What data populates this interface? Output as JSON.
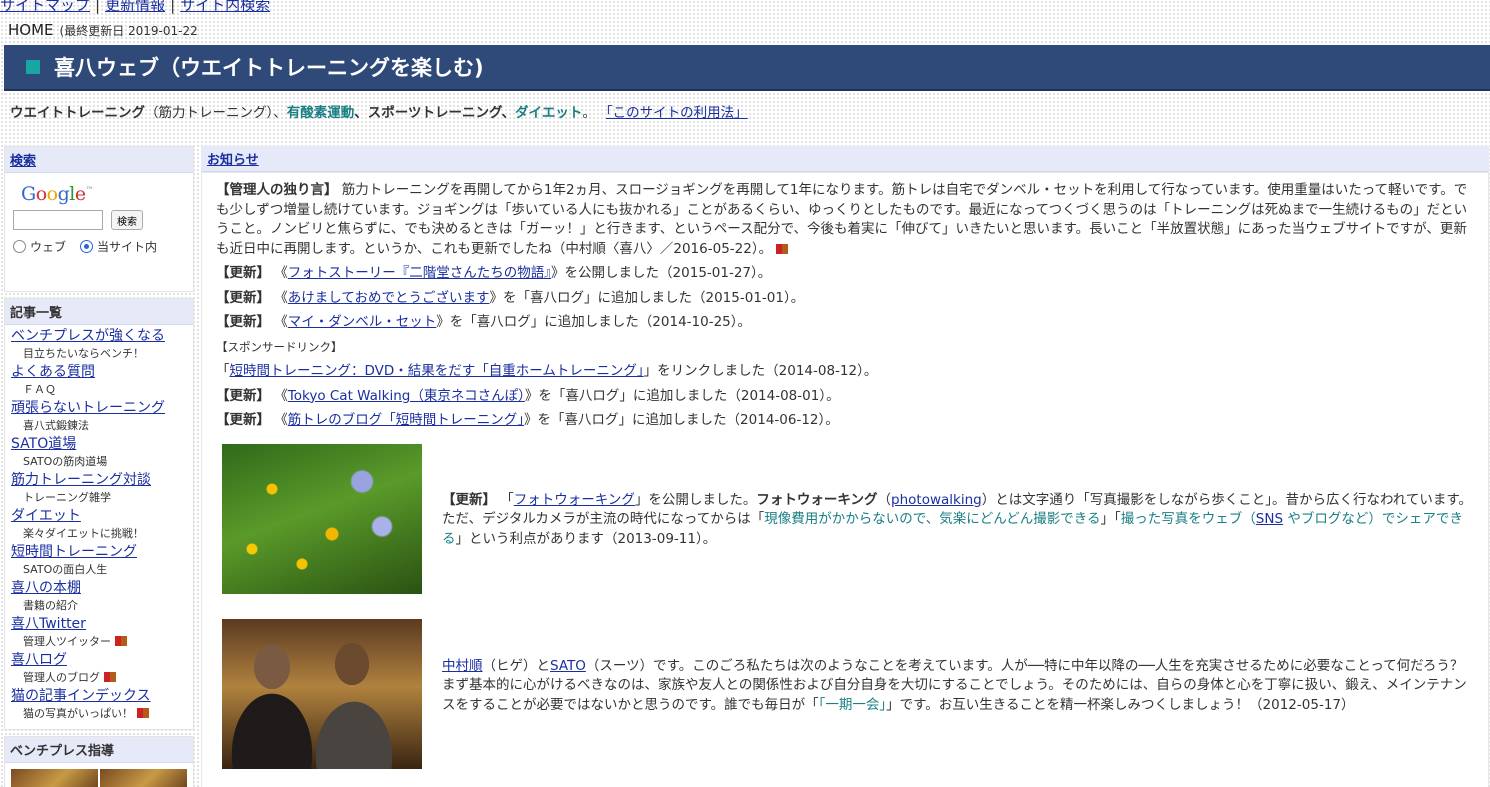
{
  "topnav": {
    "sitemap": "サイトマップ",
    "updates": "更新情報",
    "search": "サイト内検索",
    "sep": "|"
  },
  "home": {
    "label": "HOME",
    "updated": "(最終更新日 2019-01-22"
  },
  "banner": {
    "title": "喜八ウェブ（ウエイトトレーニングを楽しむ)"
  },
  "tagline": {
    "wt": "ウエイトトレーニング",
    "wt_note": "（筋力トレーニング）、",
    "aerobic": "有酸素運動",
    "sports": "、スポーツトレーニング、",
    "diet": "ダイエット",
    "period": "。",
    "howto": "「このサイトの利用法」"
  },
  "sidebar": {
    "search_title": "検索",
    "google": [
      "G",
      "o",
      "o",
      "g",
      "l",
      "e"
    ],
    "google_tm": "™",
    "search_button": "検索",
    "radio_web": "ウェブ",
    "radio_site": "当サイト内",
    "articles_title": "記事一覧",
    "articles": [
      {
        "label": "ベンチプレスが強くなる",
        "sub": "目立ちたいならベンチ！"
      },
      {
        "label": "よくある質問",
        "sub": "ＦＡＱ"
      },
      {
        "label": "頑張らないトレーニング",
        "sub": "喜八式鍛錬法"
      },
      {
        "label": "SATO道場",
        "sub": "SATOの筋肉道場"
      },
      {
        "label": "筋力トレーニング対談",
        "sub": "トレーニング雑学"
      },
      {
        "label": "ダイエット",
        "sub": "楽々ダイエットに挑戦！"
      },
      {
        "label": "短時間トレーニング",
        "sub": "SATOの面白人生"
      },
      {
        "label": "喜八の本棚",
        "sub": "書籍の紹介"
      },
      {
        "label": "喜八Twitter",
        "sub": "管理人ツイッター"
      },
      {
        "label": "喜八ログ",
        "sub": "管理人のブログ"
      },
      {
        "label": "猫の記事インデックス",
        "sub": "猫の写真がいっぱい！"
      }
    ],
    "bench_title": "ベンチプレス指導"
  },
  "main": {
    "title": "お知らせ",
    "notice": {
      "label": "【管理人の独り言】",
      "text": "筋力トレーニングを再開してから1年2ヵ月、スロージョギングを再開して1年になります。筋トレは自宅でダンベル・セットを利用して行なっています。使用重量はいたって軽いです。でも少しずつ増量し続けています。ジョギングは「歩いている人にも抜かれる」ことがあるくらい、ゆっくりとしたものです。最近になってつくづく思うのは「トレーニングは死ぬまで一生続けるもの」だということ。ノンビリと焦らずに、でも決めるときは「ガーッ！」と行きます、というペース配分で、今後も着実に「伸びて」いきたいと思います。長いこと「半放置状態」にあった当ウェブサイトですが、更新も近日中に再開します。というか、これも更新でしたね（中村順〈喜八〉／2016-05-22）。"
    },
    "update_label": "【更新】",
    "updates": [
      {
        "pre": "《",
        "link": "フォトストーリー『二階堂さんたちの物語』",
        "post": "》を公開しました（2015-01-27）。"
      },
      {
        "pre": "《",
        "link": "あけましておめでとうございます",
        "post": "》を「喜八ログ」に追加しました（2015-01-01）。"
      },
      {
        "pre": "《",
        "link": "マイ・ダンベル・セット",
        "post": "》を「喜八ログ」に追加しました（2014-10-25）。"
      }
    ],
    "sponsor_label": "【スポンサードリンク】",
    "sponsor": {
      "pre": "「",
      "link": "短時間トレーニング：DVD・結果をだす「自重ホームトレーニング」",
      "post": "」をリンクしました（2014-08-12）。"
    },
    "updates2": [
      {
        "pre": "《",
        "link": "Tokyo Cat Walking（東京ネコさんぽ）",
        "post": "》を「喜八ログ」に追加しました（2014-08-01）。"
      },
      {
        "pre": "《",
        "link": "筋トレのブログ「短時間トレーニング」",
        "post": "》を「喜八ログ」に追加しました（2014-06-12）。"
      }
    ],
    "photo1": {
      "label": "【更新】",
      "q1": "「",
      "link": "フォトウォーキング",
      "t1": "」を公開しました。",
      "bold": "フォトウォーキング",
      "t2": "（",
      "link2": "photowalking",
      "t3": "）とは文字通り「写真撮影をしながら歩くこと」。昔から広く行なわれています。ただ、デジタルカメラが主流の時代になってからは「",
      "teal1": "現像費用がかからないので、気楽にどんどん撮影できる",
      "t4": "」「",
      "teal2": "撮った写真をウェブ（",
      "link3": "SNS",
      "teal3": " やブログなど）でシェアできる",
      "t5": "」という利点があります（2013-09-11）。"
    },
    "photo2": {
      "link1": "中村順",
      "t1": "（ヒゲ）と",
      "link2": "SATO",
      "t2": "（スーツ）です。このごろ私たちは次のようなことを考えています。人が──特に中年以降の──人生を充実させるために必要なことって何だろう？ まず基本的に心がけるべきなのは、家族や友人との関係性および自分自身を大切にすることでしょう。そのためには、自らの身体と心を丁寧に扱い、鍛え、メインテナンスをすることが必要ではないかと思うのです。誰でも毎日が「",
      "teal": "「一期一会」",
      "t3": "」です。お互い生きることを精一杯楽しみつくしましょう！（2012-05-17）"
    }
  }
}
